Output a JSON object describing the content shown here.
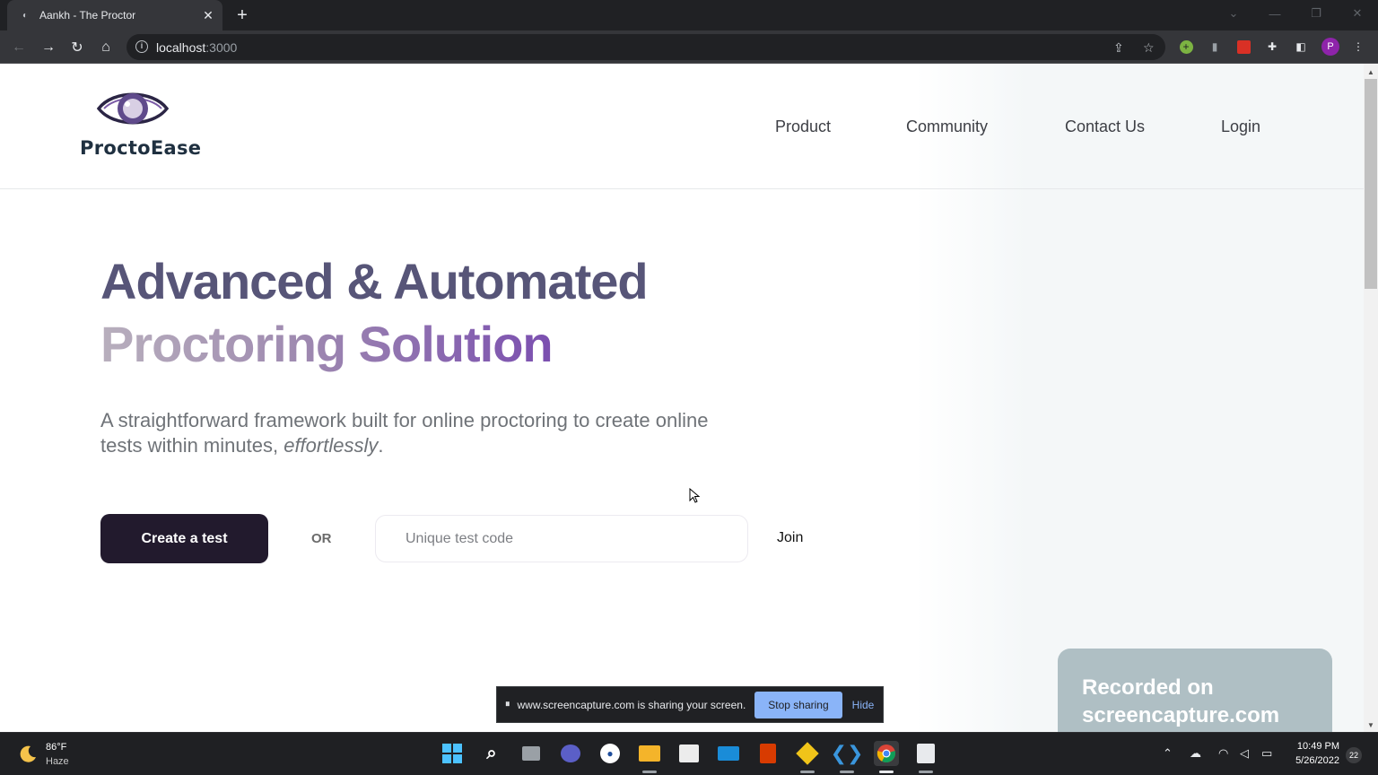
{
  "browser": {
    "tab_title": "Aankh - The Proctor",
    "url_host": "localhost",
    "url_port": ":3000",
    "profile_initial": "P"
  },
  "site": {
    "logo_text": "ProctoEase",
    "nav": {
      "product": "Product",
      "community": "Community",
      "contact": "Contact Us",
      "login": "Login"
    },
    "hero": {
      "title_line1": "Advanced & Automated",
      "title_line2": "Proctoring Solution",
      "subtitle_main": "A straightforward framework built for online proctoring to create online tests within minutes,",
      "subtitle_emphasis": "effortlessly",
      "subtitle_end": "."
    },
    "actions": {
      "create_label": "Create a test",
      "or_label": "OR",
      "code_placeholder": "Unique test code",
      "join_label": "Join"
    },
    "colors": {
      "title_primary": "#575578",
      "title_gradient_end": "#7b4fb0",
      "button_dark": "#221a2d"
    }
  },
  "screen_share": {
    "message": "www.screencapture.com is sharing your screen.",
    "stop_label": "Stop sharing",
    "hide_label": "Hide"
  },
  "watermark": {
    "line1": "Recorded on",
    "line2": "screencapture.com"
  },
  "taskbar": {
    "weather_temp": "86°F",
    "weather_desc": "Haze",
    "time": "10:49 PM",
    "date": "5/26/2022",
    "notifications": "22",
    "apps": [
      "start-icon",
      "search-icon",
      "file-explorer-icon",
      "teams-chat-icon",
      "app-icon",
      "folder-icon",
      "store-icon",
      "mail-icon",
      "office-icon",
      "git-icon",
      "vscode-icon",
      "chrome-icon",
      "snipping-tool-icon"
    ]
  }
}
